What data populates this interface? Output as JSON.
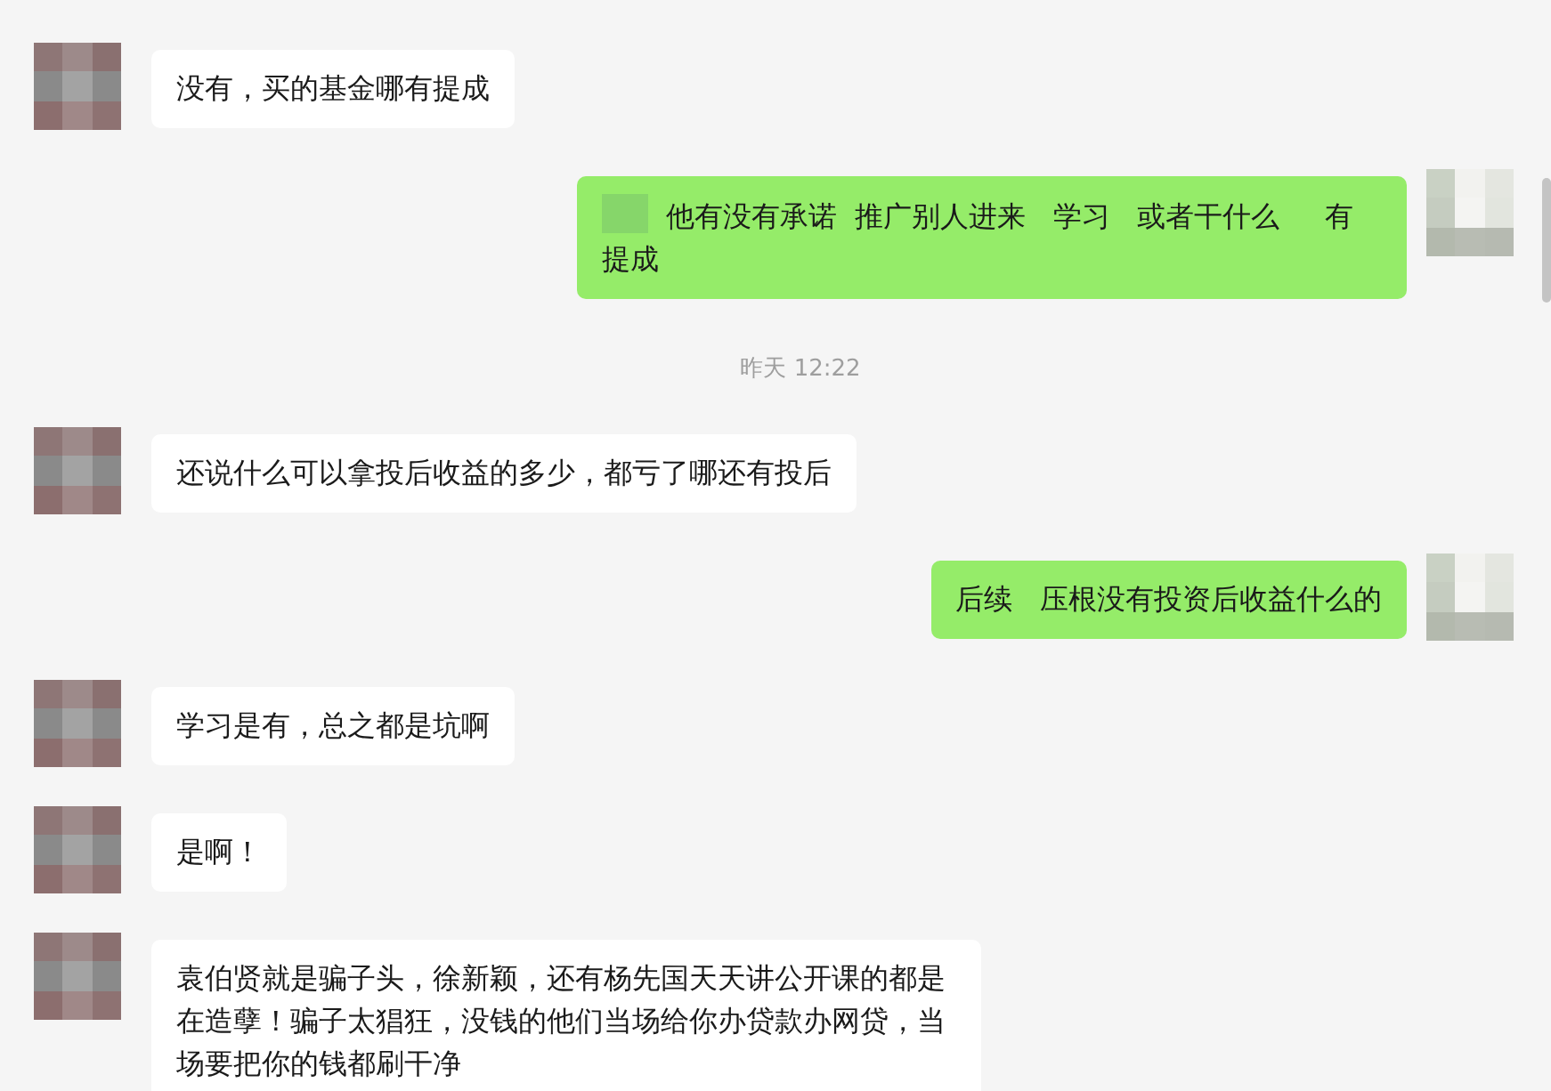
{
  "messages": [
    {
      "kind": "message",
      "outgoing": false,
      "emoji": false,
      "text": "没有，买的基金哪有提成"
    },
    {
      "kind": "message",
      "outgoing": true,
      "emoji": true,
      "text": "他有没有承诺  推广别人进来   学习   或者干什么     有提成"
    },
    {
      "kind": "time",
      "text": "昨天 12:22"
    },
    {
      "kind": "message",
      "outgoing": false,
      "emoji": false,
      "text": "还说什么可以拿投后收益的多少，都亏了哪还有投后"
    },
    {
      "kind": "message",
      "outgoing": true,
      "emoji": false,
      "text": "后续   压根没有投资后收益什么的"
    },
    {
      "kind": "message",
      "outgoing": false,
      "emoji": false,
      "text": "学习是有，总之都是坑啊"
    },
    {
      "kind": "message",
      "outgoing": false,
      "emoji": false,
      "text": "是啊！"
    },
    {
      "kind": "message",
      "outgoing": false,
      "emoji": false,
      "text": "袁伯贤就是骗子头，徐新颖，还有杨先国天天讲公开课的都是在造孽！骗子太猖狂，没钱的他们当场给你办贷款办网贷，当场要把你的钱都刷干净"
    }
  ]
}
